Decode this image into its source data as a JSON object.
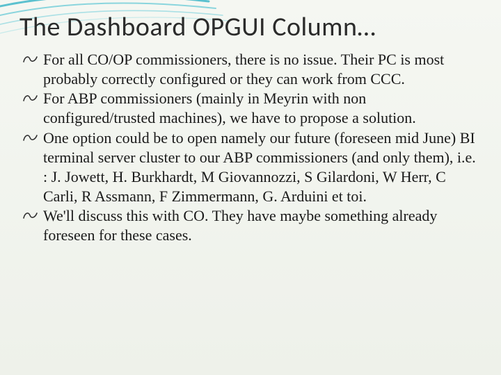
{
  "slide": {
    "title": "The Dashboard OPGUI Column…",
    "bullets": [
      "For all CO/OP commissioners, there is no issue. Their PC is most probably correctly configured or they can work from CCC.",
      "For ABP commissioners (mainly in Meyrin with non configured/trusted machines), we have to propose a solution.",
      " One option could be to open namely our future (foreseen mid June) BI terminal server cluster to our ABP commissioners (and only them), i.e. : J. Jowett, H. Burkhardt, M Giovannozzi, S Gilardoni, W Herr, C Carli, R Assmann, F Zimmermann, G. Arduini et toi.",
      " We'll discuss this with CO. They have maybe something already foreseen for these cases."
    ]
  }
}
